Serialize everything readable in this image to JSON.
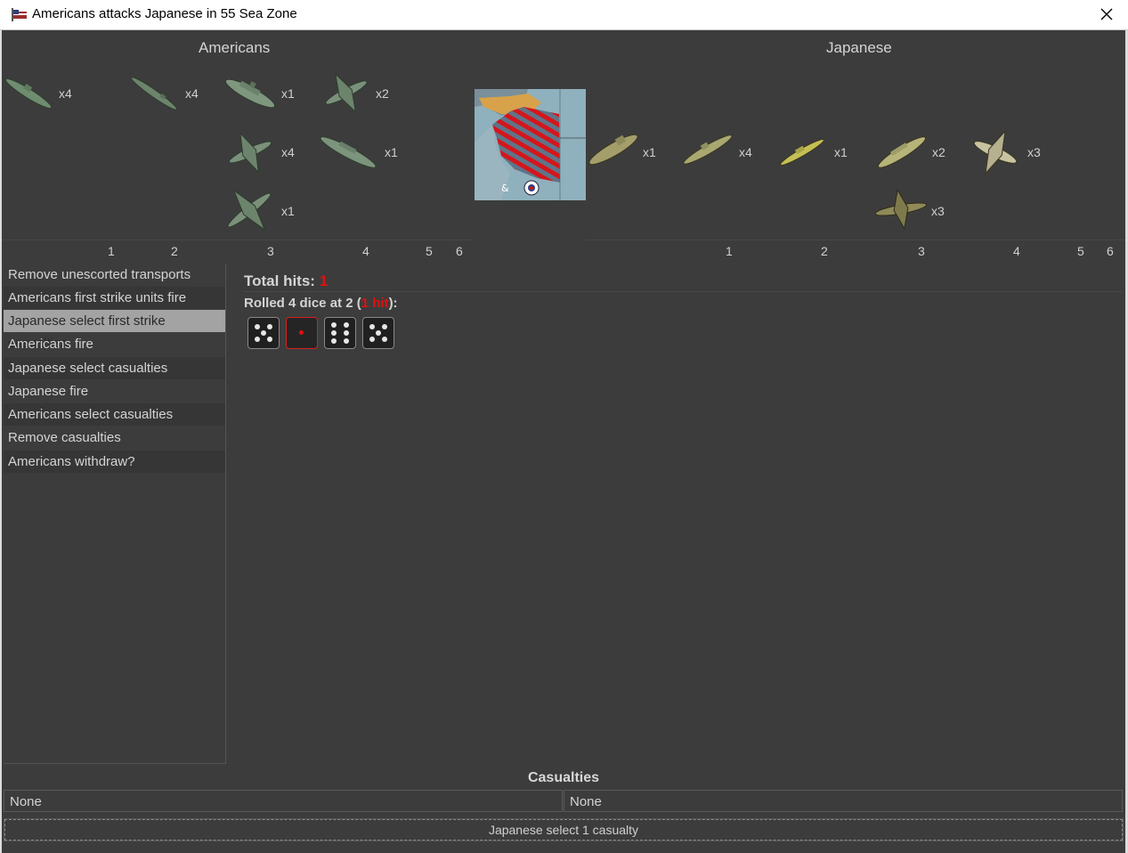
{
  "window": {
    "title": "Americans attacks Japanese in 55 Sea Zone"
  },
  "sides": {
    "attacker": "Americans",
    "defender": "Japanese"
  },
  "attacker_units": [
    {
      "name": "submarine",
      "count": "x4"
    },
    {
      "name": "transport",
      "count": "x4"
    },
    {
      "name": "battleship",
      "count": "x1"
    },
    {
      "name": "fighter",
      "count": "x2"
    },
    {
      "name": "fighter",
      "count": "x4"
    },
    {
      "name": "cruiser",
      "count": "x1"
    },
    {
      "name": "bomber",
      "count": "x1"
    }
  ],
  "defender_units": [
    {
      "name": "transport",
      "count": "x1"
    },
    {
      "name": "submarine",
      "count": "x4"
    },
    {
      "name": "destroyer",
      "count": "x1"
    },
    {
      "name": "cruiser",
      "count": "x2"
    },
    {
      "name": "fighter",
      "count": "x3"
    },
    {
      "name": "bomber",
      "count": "x3"
    }
  ],
  "attacker_ruler": [
    "1",
    "2",
    "3",
    "4",
    "5",
    "6"
  ],
  "defender_ruler": [
    "1",
    "2",
    "3",
    "4",
    "5",
    "6"
  ],
  "steps": [
    {
      "label": "Remove unescorted transports"
    },
    {
      "label": "Americans first strike units fire"
    },
    {
      "label": "Japanese select first strike casualties",
      "selected": true
    },
    {
      "label": "Americans fire"
    },
    {
      "label": "Japanese select casualties"
    },
    {
      "label": "Japanese fire"
    },
    {
      "label": "Americans select casualties"
    },
    {
      "label": "Remove casualties"
    },
    {
      "label": "Americans withdraw?"
    }
  ],
  "results": {
    "total_hits_label": "Total hits:",
    "total_hits_value": "1",
    "roll_prefix": "Rolled 4 dice at 2 (",
    "roll_hits": "1 hit",
    "roll_suffix": "):",
    "dice": [
      5,
      1,
      6,
      5
    ],
    "hit_color": "#e01010"
  },
  "casualties": {
    "title": "Casualties",
    "attacker": "None",
    "defender": "None"
  },
  "status": {
    "label": "Japanese select 1 casualty"
  }
}
